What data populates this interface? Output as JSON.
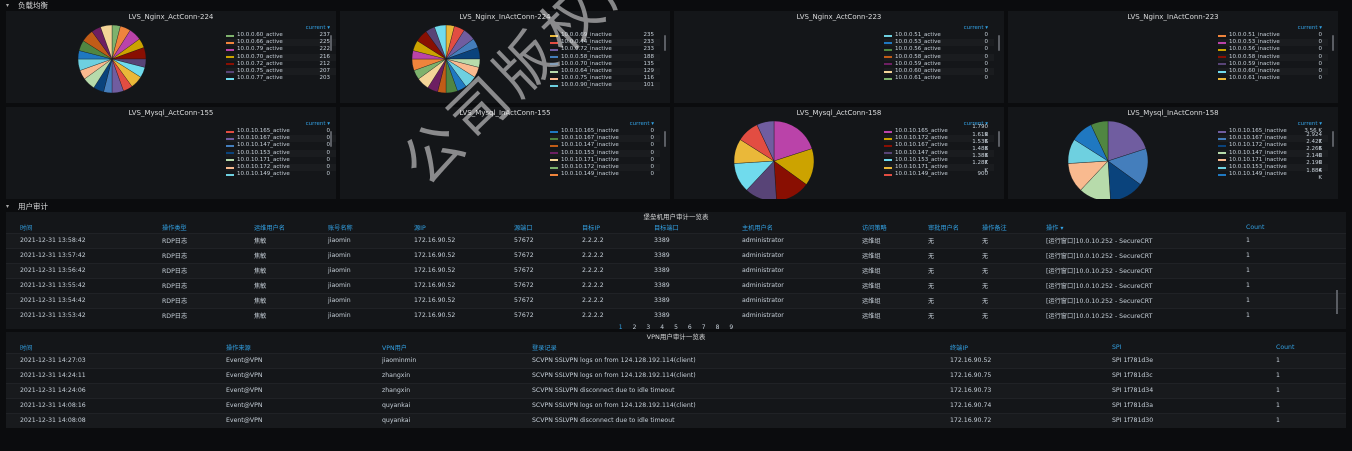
{
  "sections": {
    "lb": "负载均衡",
    "audit": "用户审计"
  },
  "colors": [
    "#7eb26d",
    "#eab839",
    "#6ed0e0",
    "#ef843c",
    "#e24d42",
    "#1f78c1",
    "#ba43a9",
    "#705da0",
    "#508642",
    "#cca300",
    "#447ebc",
    "#c15c17",
    "#890f02",
    "#0a437c",
    "#6d1f62",
    "#584477",
    "#b7dbab",
    "#f4d598",
    "#70dbed",
    "#f9ba8f"
  ],
  "panels": [
    {
      "title": "LVS_Nginx_ActConn-224",
      "header": "current ▾",
      "pie": true,
      "slices": 20,
      "legend": [
        {
          "label": "10.0.0.60_active",
          "value": "237"
        },
        {
          "label": "10.0.0.66_active",
          "value": "225"
        },
        {
          "label": "10.0.0.79_active",
          "value": "222"
        },
        {
          "label": "10.0.0.70_active",
          "value": "216"
        },
        {
          "label": "10.0.0.72_active",
          "value": "212"
        },
        {
          "label": "10.0.0.75_active",
          "value": "207"
        },
        {
          "label": "10.0.0.77_active",
          "value": "203"
        }
      ]
    },
    {
      "title": "LVS_Nginx_InActConn-224",
      "header": "",
      "pie": true,
      "slices": 20,
      "legend": [
        {
          "label": "10.0.0.69_inactive",
          "value": "235"
        },
        {
          "label": "10.0.0.44_inactive",
          "value": "233"
        },
        {
          "label": "10.0.0.72_inactive",
          "value": "233"
        },
        {
          "label": "10.0.0.58_inactive",
          "value": "188"
        },
        {
          "label": "10.0.0.70_inactive",
          "value": "135"
        },
        {
          "label": "10.0.0.64_inactive",
          "value": "129"
        },
        {
          "label": "10.0.0.75_inactive",
          "value": "116"
        },
        {
          "label": "10.0.0.90_inactive",
          "value": "101"
        }
      ]
    },
    {
      "title": "LVS_Nginx_ActConn-223",
      "header": "current ▾",
      "pie": false,
      "legend": [
        {
          "label": "10.0.0.51_active",
          "value": "0"
        },
        {
          "label": "10.0.0.53_active",
          "value": "0"
        },
        {
          "label": "10.0.0.56_active",
          "value": "0"
        },
        {
          "label": "10.0.0.58_active",
          "value": "0"
        },
        {
          "label": "10.0.0.59_active",
          "value": "0"
        },
        {
          "label": "10.0.0.60_active",
          "value": "0"
        },
        {
          "label": "10.0.0.61_active",
          "value": "0"
        }
      ]
    },
    {
      "title": "LVS_Nginx_InActConn-223",
      "header": "current ▾",
      "pie": false,
      "legend": [
        {
          "label": "10.0.0.51_inactive",
          "value": "0"
        },
        {
          "label": "10.0.0.53_inactive",
          "value": "0"
        },
        {
          "label": "10.0.0.56_inactive",
          "value": "0"
        },
        {
          "label": "10.0.0.58_inactive",
          "value": "0"
        },
        {
          "label": "10.0.0.59_inactive",
          "value": "0"
        },
        {
          "label": "10.0.0.60_inactive",
          "value": "0"
        },
        {
          "label": "10.0.0.61_inactive",
          "value": "0"
        }
      ]
    },
    {
      "title": "LVS_Mysql_ActConn-155",
      "header": "current ▾",
      "pie": false,
      "legend": [
        {
          "label": "10.0.10.165_active",
          "value": "0"
        },
        {
          "label": "10.0.10.167_active",
          "value": "0"
        },
        {
          "label": "10.0.10.147_active",
          "value": "0"
        },
        {
          "label": "10.0.10.153_active",
          "value": "0"
        },
        {
          "label": "10.0.10.171_active",
          "value": "0"
        },
        {
          "label": "10.0.10.172_active",
          "value": "0"
        },
        {
          "label": "10.0.10.149_active",
          "value": "0"
        }
      ]
    },
    {
      "title": "LVS_Mysql_InActConn-155",
      "header": "current ▾",
      "pie": false,
      "legend": [
        {
          "label": "10.0.10.165_inactive",
          "value": "0"
        },
        {
          "label": "10.0.10.167_inactive",
          "value": "0"
        },
        {
          "label": "10.0.10.147_inactive",
          "value": "0"
        },
        {
          "label": "10.0.10.153_inactive",
          "value": "0"
        },
        {
          "label": "10.0.10.171_inactive",
          "value": "0"
        },
        {
          "label": "10.0.10.172_inactive",
          "value": "0"
        },
        {
          "label": "10.0.10.149_inactive",
          "value": "0"
        }
      ]
    },
    {
      "title": "LVS_Mysql_ActConn-158",
      "header": "current ▾",
      "pie": true,
      "slices": 8,
      "legend": [
        {
          "label": "10.0.10.165_active",
          "value": "1.790 K"
        },
        {
          "label": "10.0.10.172_active",
          "value": "1.619 K"
        },
        {
          "label": "10.0.10.167_active",
          "value": "1.536 K"
        },
        {
          "label": "10.0.10.147_active",
          "value": "1.488 K"
        },
        {
          "label": "10.0.10.153_active",
          "value": "1.383 K"
        },
        {
          "label": "10.0.10.171_active",
          "value": "1.287 K"
        },
        {
          "label": "10.0.10.149_active",
          "value": "900"
        }
      ]
    },
    {
      "title": "LVS_Mysql_InActConn-158",
      "header": "current ▾",
      "pie": true,
      "slices": 8,
      "legend": [
        {
          "label": "10.0.10.165_inactive",
          "value": "3.56 K"
        },
        {
          "label": "10.0.10.167_inactive",
          "value": "2.924 K"
        },
        {
          "label": "10.0.10.172_inactive",
          "value": "2.427 K"
        },
        {
          "label": "10.0.10.147_inactive",
          "value": "2.266 K"
        },
        {
          "label": "10.0.10.171_inactive",
          "value": "2.140 K"
        },
        {
          "label": "10.0.10.153_inactive",
          "value": "2.190 K"
        },
        {
          "label": "10.0.10.149_inactive",
          "value": "1.884 K"
        }
      ]
    }
  ],
  "table1": {
    "title": "堡垒机用户审计一览表",
    "headers": [
      "时间",
      "操作类型",
      "运维用户名",
      "账号名称",
      "源IP",
      "源端口",
      "目标IP",
      "目标端口",
      "主机用户名",
      "访问策略",
      "审批用户名",
      "操作备注",
      "操作 ▾",
      "Count"
    ],
    "rows": [
      [
        "2021-12-31 13:58:42",
        "RDP日志",
        "焦敏",
        "jiaomin",
        "172.16.90.52",
        "57672",
        "2.2.2.2",
        "3389",
        "administrator",
        "运维组",
        "无",
        "无",
        "[运行窗口]10.0.10.252 - SecureCRT",
        "1"
      ],
      [
        "2021-12-31 13:57:42",
        "RDP日志",
        "焦敏",
        "jiaomin",
        "172.16.90.52",
        "57672",
        "2.2.2.2",
        "3389",
        "administrator",
        "运维组",
        "无",
        "无",
        "[运行窗口]10.0.10.252 - SecureCRT",
        "1"
      ],
      [
        "2021-12-31 13:56:42",
        "RDP日志",
        "焦敏",
        "jiaomin",
        "172.16.90.52",
        "57672",
        "2.2.2.2",
        "3389",
        "administrator",
        "运维组",
        "无",
        "无",
        "[运行窗口]10.0.10.252 - SecureCRT",
        "1"
      ],
      [
        "2021-12-31 13:55:42",
        "RDP日志",
        "焦敏",
        "jiaomin",
        "172.16.90.52",
        "57672",
        "2.2.2.2",
        "3389",
        "administrator",
        "运维组",
        "无",
        "无",
        "[运行窗口]10.0.10.252 - SecureCRT",
        "1"
      ],
      [
        "2021-12-31 13:54:42",
        "RDP日志",
        "焦敏",
        "jiaomin",
        "172.16.90.52",
        "57672",
        "2.2.2.2",
        "3389",
        "administrator",
        "运维组",
        "无",
        "无",
        "[运行窗口]10.0.10.252 - SecureCRT",
        "1"
      ],
      [
        "2021-12-31 13:53:42",
        "RDP日志",
        "焦敏",
        "jiaomin",
        "172.16.90.52",
        "57672",
        "2.2.2.2",
        "3389",
        "administrator",
        "运维组",
        "无",
        "无",
        "[运行窗口]10.0.10.252 - SecureCRT",
        "1"
      ]
    ],
    "pages": [
      "1",
      "2",
      "3",
      "4",
      "5",
      "6",
      "7",
      "8",
      "9"
    ]
  },
  "table2": {
    "title": "VPN用户审计一览表",
    "headers": [
      "时间",
      "操作来源",
      "VPN用户",
      "登录记录",
      "终端IP",
      "SPI",
      "Count"
    ],
    "rows": [
      [
        "2021-12-31 14:27:03",
        "Event@VPN",
        "jiaominmin",
        "SCVPN SSLVPN logs on from 124.128.192.114(client)",
        "172.16.90.52",
        "SPI 1f781d3e",
        "1"
      ],
      [
        "2021-12-31 14:24:11",
        "Event@VPN",
        "zhangxin",
        "SCVPN SSLVPN logs on from 124.128.192.114(client)",
        "172.16.90.75",
        "SPI 1f781d3c",
        "1"
      ],
      [
        "2021-12-31 14:24:06",
        "Event@VPN",
        "zhangxin",
        "SCVPN SSLVPN disconnect due to idle timeout",
        "172.16.90.73",
        "SPI 1f781d34",
        "1"
      ],
      [
        "2021-12-31 14:08:16",
        "Event@VPN",
        "quyankai",
        "SCVPN SSLVPN logs on from 124.128.192.114(client)",
        "172.16.90.74",
        "SPI 1f781d3a",
        "1"
      ],
      [
        "2021-12-31 14:08:08",
        "Event@VPN",
        "quyankai",
        "SCVPN SSLVPN disconnect due to idle timeout",
        "172.16.90.72",
        "SPI 1f781d30",
        "1"
      ]
    ]
  },
  "watermark": "公司版权所有"
}
